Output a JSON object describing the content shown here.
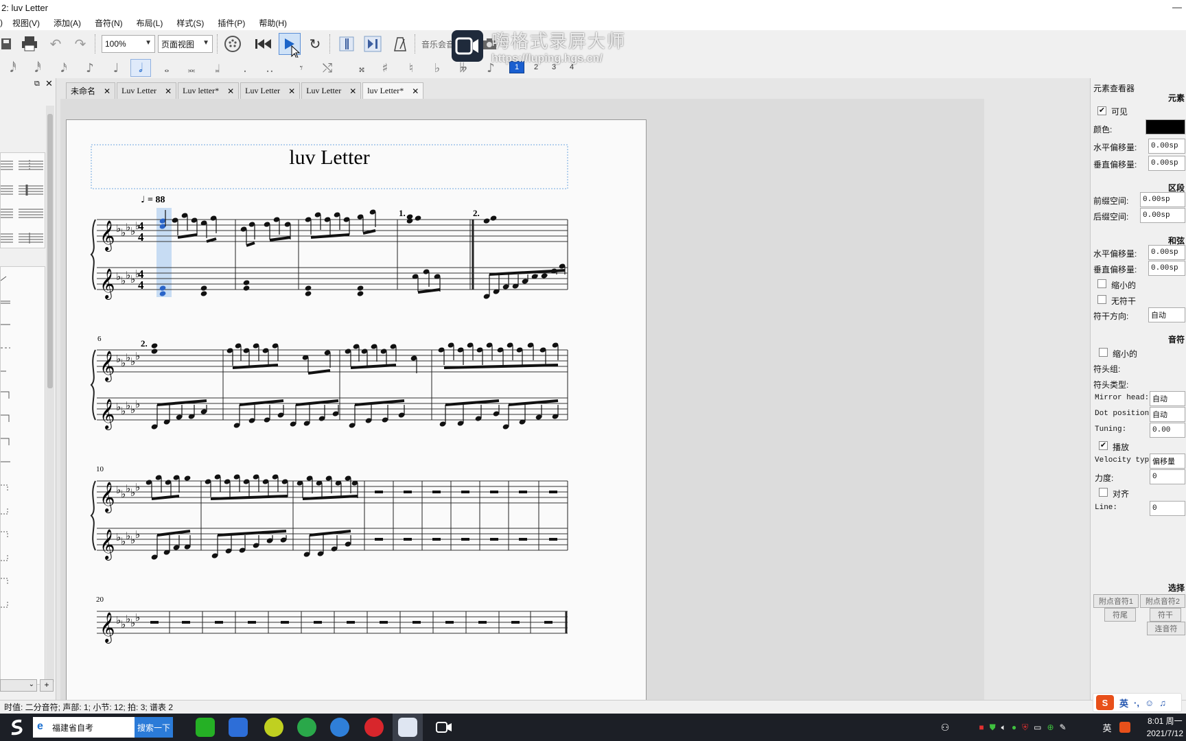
{
  "window": {
    "title": "2: luv Letter"
  },
  "menu": [
    "视图(V)",
    "添加(A)",
    "音符(N)",
    "布局(L)",
    "样式(S)",
    "插件(P)",
    "帮助(H)"
  ],
  "toolbar": {
    "zoom": "100%",
    "view_mode": "页面视图",
    "concert_pitch": "音乐会音高"
  },
  "note_input": {
    "voices": [
      "1",
      "2",
      "3",
      "4"
    ],
    "active_voice": "1"
  },
  "watermark": {
    "name": "嗨格式录屏大师",
    "url": "https://luping.hgs.cn/"
  },
  "tabs": [
    {
      "label": "未命名",
      "active": false
    },
    {
      "label": "Luv Letter",
      "active": false
    },
    {
      "label": "Luv letter*",
      "active": false
    },
    {
      "label": "Luv Letter",
      "active": false
    },
    {
      "label": "Luv Letter",
      "active": false
    },
    {
      "label": "luv Letter*",
      "active": true
    }
  ],
  "score": {
    "title": "luv Letter",
    "tempo_note": "♩",
    "tempo": "= 88",
    "volta_1": "1.",
    "volta_2": "2.",
    "measure_numbers": [
      "6",
      "10",
      "20"
    ],
    "key_signature": "Db major (5 flats)",
    "time_signature": "4/4"
  },
  "inspector": {
    "title": "元素查看器",
    "element_header": "元素",
    "visible": "可见",
    "color_label": "颜色:",
    "color_value": "#000000",
    "h_offset_label": "水平偏移量:",
    "h_offset": "0.00sp",
    "v_offset_label": "垂直偏移量:",
    "v_offset": "0.00sp",
    "segment_header": "区段",
    "leading_label": "前缀空间:",
    "leading": "0.00sp",
    "trailing_label": "后缀空间:",
    "trailing": "0.00sp",
    "chord_header": "和弦",
    "chord_h_offset_label": "水平偏移量:",
    "chord_h_offset": "0.00sp",
    "chord_v_offset_label": "垂直偏移量:",
    "chord_v_offset": "0.00sp",
    "small": "缩小的",
    "no_stem": "无符干",
    "stem_dir_label": "符干方向:",
    "stem_dir": "自动",
    "note_header": "音符",
    "note_small": "缩小的",
    "head_group_label": "符头组:",
    "head_type_label": "符头类型:",
    "mirror_label": "Mirror head:",
    "mirror": "自动",
    "dot_label": "Dot position:",
    "dot": "自动",
    "tuning_label": "Tuning:",
    "tuning": "0.00",
    "play": "播放",
    "velocity_type_label": "Velocity type:",
    "velocity_type": "偏移量",
    "velocity_label": "力度:",
    "velocity": "0",
    "align": "对齐",
    "line_label": "Line:",
    "line": "0",
    "select_header": "选择",
    "btn_dot1": "附点音符1",
    "btn_dot2": "附点音符2",
    "btn_flag": "符尾",
    "btn_stem": "符干",
    "btn_beam": "连音符"
  },
  "status": "时值: 二分音符; 声部: 1; 小节: 12; 拍: 3; 谱表 2",
  "taskbar": {
    "search_text": "福建省自考",
    "search_button": "搜索一下",
    "ime_lang": "英",
    "clock_time": "8:01 周一",
    "clock_date": "2021/7/12"
  },
  "ime": {
    "logo": "S",
    "lang": "英"
  }
}
